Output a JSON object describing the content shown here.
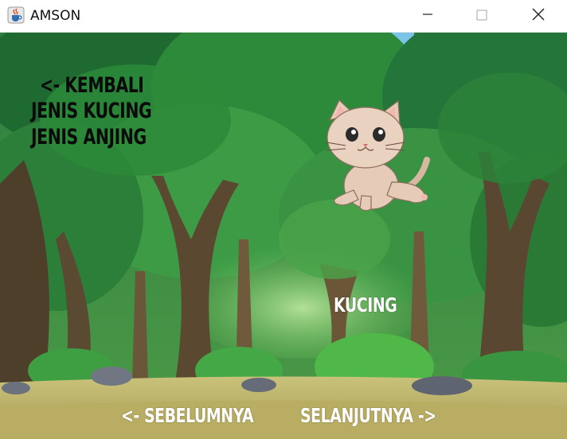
{
  "window": {
    "title": "AMSON",
    "app_icon": "java-cup-icon",
    "controls": [
      "minimize-icon",
      "maximize-icon",
      "close-icon"
    ]
  },
  "menu": {
    "back": "<- KEMBALI",
    "cat_types": "JENIS KUCING",
    "dog_types": "JENIS ANJING"
  },
  "animal": {
    "name": "KUCING",
    "image": "cat-illustration"
  },
  "nav": {
    "previous": "<- SEBELUMNYA",
    "next": "SELANJUTNYA ->"
  }
}
